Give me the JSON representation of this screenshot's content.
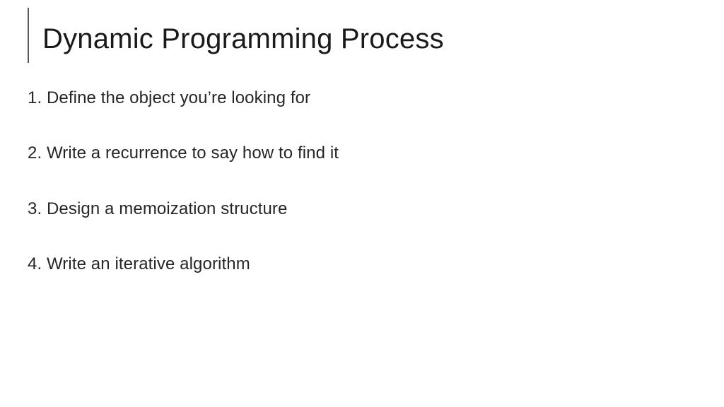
{
  "slide": {
    "title": "Dynamic Programming Process",
    "items": [
      "1. Define the object you’re looking for",
      "2. Write a recurrence to say how to find it",
      "3. Design a memoization structure",
      "4. Write an iterative algorithm"
    ]
  }
}
